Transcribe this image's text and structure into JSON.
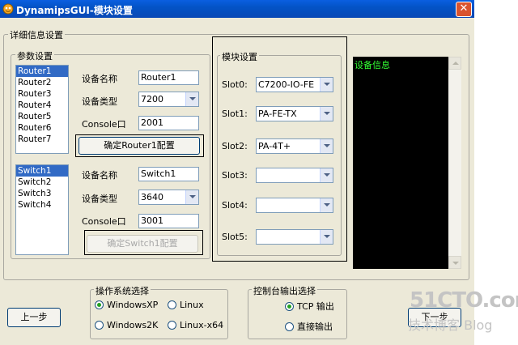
{
  "window": {
    "title": "DynamipsGUI-模块设置",
    "close": "✕"
  },
  "details_group": {
    "label": "详细信息设置"
  },
  "params_group": {
    "label": "参数设置"
  },
  "routers": {
    "items": [
      "Router1",
      "Router2",
      "Router3",
      "Router4",
      "Router5",
      "Router6",
      "Router7"
    ],
    "selected": "Router1",
    "name_label": "设备名称",
    "name_value": "Router1",
    "type_label": "设备类型",
    "type_value": "7200",
    "console_label": "Console口",
    "console_value": "2001",
    "confirm_label": "确定Router1配置"
  },
  "switches": {
    "items": [
      "Switch1",
      "Switch2",
      "Switch3",
      "Switch4"
    ],
    "selected": "Switch1",
    "name_label": "设备名称",
    "name_value": "Switch1",
    "type_label": "设备类型",
    "type_value": "3640",
    "console_label": "Console口",
    "console_value": "3001",
    "confirm_label": "确定Switch1配置"
  },
  "modules": {
    "label": "模块设置",
    "slots": [
      {
        "label": "Slot0:",
        "value": "C7200-IO-FE"
      },
      {
        "label": "Slot1:",
        "value": "PA-FE-TX"
      },
      {
        "label": "Slot2:",
        "value": "PA-4T+"
      },
      {
        "label": "Slot3:",
        "value": ""
      },
      {
        "label": "Slot4:",
        "value": ""
      },
      {
        "label": "Slot5:",
        "value": ""
      }
    ]
  },
  "info": {
    "title": "设备信息"
  },
  "os_group": {
    "label": "操作系统选择",
    "options": [
      {
        "label": "WindowsXP",
        "checked": true
      },
      {
        "label": "Linux",
        "checked": false
      },
      {
        "label": "Windows2K",
        "checked": false
      },
      {
        "label": "Linux-x64",
        "checked": false
      }
    ]
  },
  "console_group": {
    "label": "控制台输出选择",
    "options": [
      {
        "label": "TCP 输出",
        "checked": true
      },
      {
        "label": "直接输出",
        "checked": false
      }
    ]
  },
  "buttons": {
    "prev": "上一步",
    "next": "下一步"
  },
  "watermark": {
    "main": "51CTO.com",
    "sub": "技术博客  Blog"
  },
  "colors": {
    "titlebar": "#0353c6",
    "selection": "#316ac5",
    "info_text": "#33ff33"
  }
}
